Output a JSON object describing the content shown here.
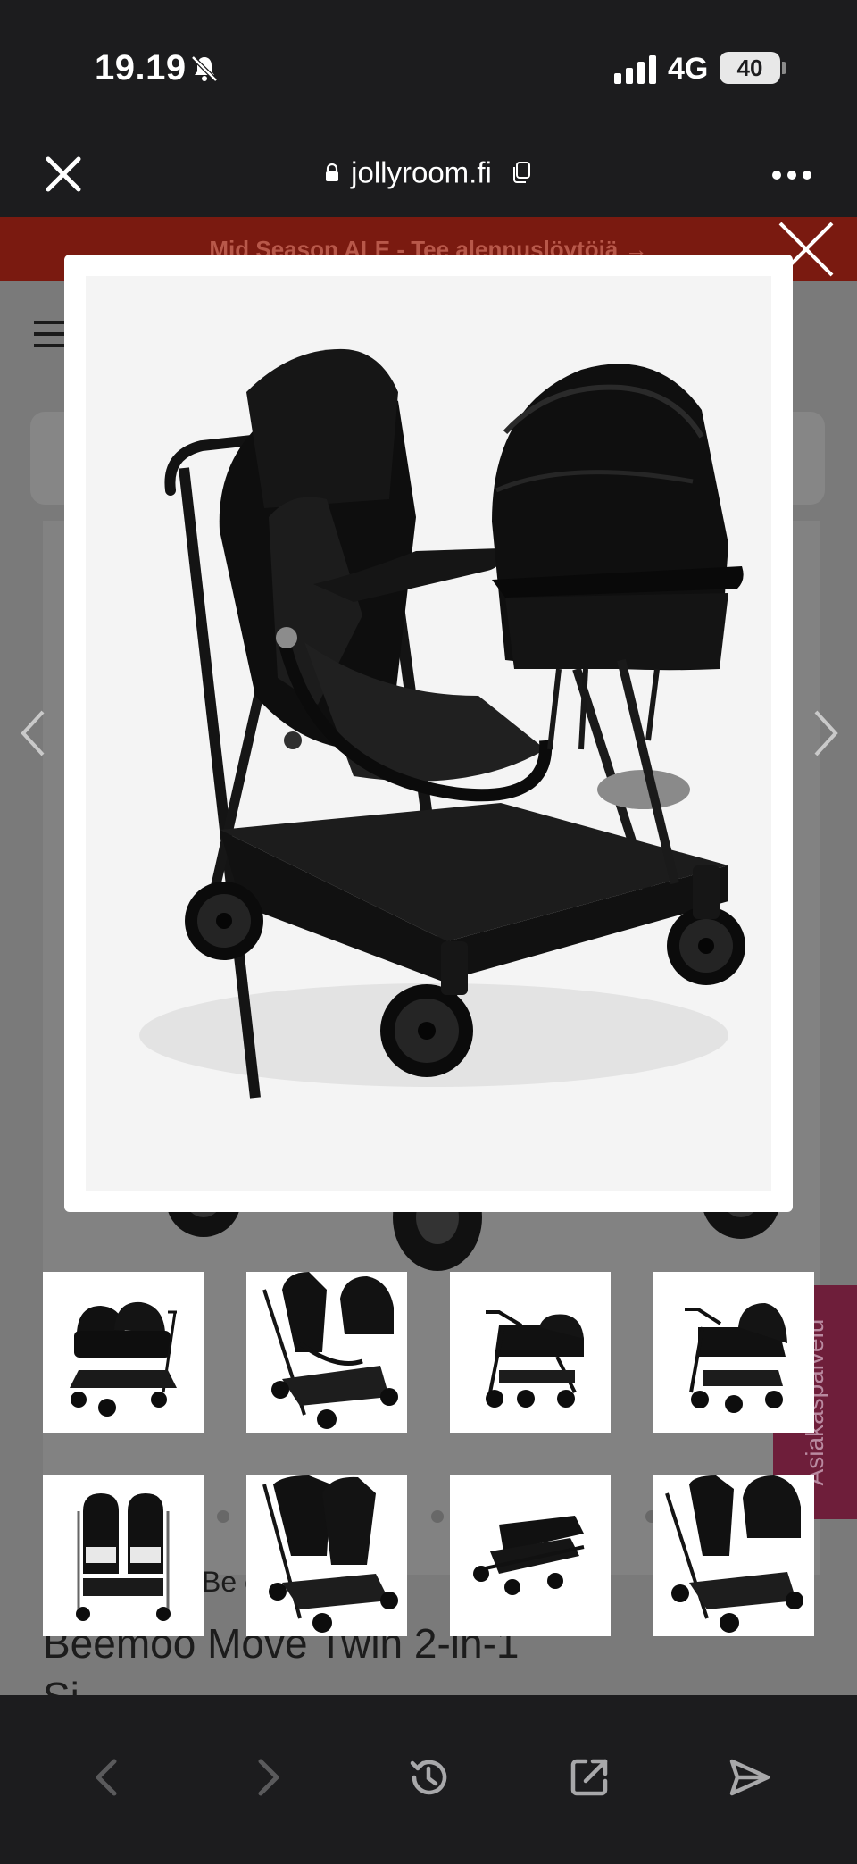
{
  "status_bar": {
    "time": "19.19",
    "network": "4G",
    "battery": "40"
  },
  "browser": {
    "url": "jollyroom.fi"
  },
  "page": {
    "promo_banner": "Mid Season ALE - Tee alennuslöytöjä →",
    "brand": "Be               e",
    "product_title_line1": "Beemoo Move Twin 2-in-1",
    "product_title_line2": "Si",
    "side_tab_label": "Asiakaspalvelu"
  },
  "modal": {
    "image_icon": "twin-stroller-image"
  },
  "thumbnails": [
    {
      "name": "thumbnail-1",
      "icon": "stroller-two-carrycots"
    },
    {
      "name": "thumbnail-2",
      "icon": "stroller-seat-and-carrycot"
    },
    {
      "name": "thumbnail-3",
      "icon": "stroller-side-view"
    },
    {
      "name": "thumbnail-4",
      "icon": "stroller-side-view-2"
    },
    {
      "name": "thumbnail-5",
      "icon": "stroller-front-view"
    },
    {
      "name": "thumbnail-6",
      "icon": "stroller-two-seats"
    },
    {
      "name": "thumbnail-7",
      "icon": "stroller-folded"
    },
    {
      "name": "thumbnail-8",
      "icon": "stroller-seat-and-carrycot-2"
    }
  ],
  "colors": {
    "promo": "#7a1a10",
    "side_tab": "#6e1e3a",
    "overlay_page": "#7a7a7a"
  }
}
